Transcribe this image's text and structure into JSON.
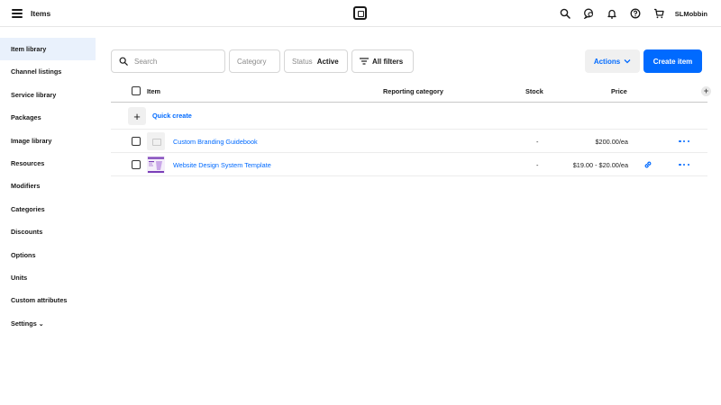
{
  "header": {
    "title": "Items",
    "username": "SLMobbin",
    "icons": [
      "hamburger-icon",
      "square-logo",
      "search-icon",
      "messages-icon",
      "bell-icon",
      "help-icon",
      "cart-icon"
    ]
  },
  "sidebar": {
    "items": [
      {
        "label": "Item library"
      },
      {
        "label": "Channel listings"
      },
      {
        "label": "Service library"
      },
      {
        "label": "Packages"
      },
      {
        "label": "Image library"
      },
      {
        "label": "Resources"
      },
      {
        "label": "Modifiers"
      },
      {
        "label": "Categories"
      },
      {
        "label": "Discounts"
      },
      {
        "label": "Options"
      },
      {
        "label": "Units"
      },
      {
        "label": "Custom attributes"
      },
      {
        "label": "Settings"
      }
    ],
    "active_index": 0
  },
  "toolbar": {
    "search_placeholder": "Search",
    "category_label": "Category",
    "status_label": "Status",
    "status_value": "Active",
    "all_filters_label": "All filters",
    "actions_label": "Actions",
    "create_label": "Create item"
  },
  "table": {
    "columns": [
      "Item",
      "Reporting category",
      "Stock",
      "Price"
    ],
    "quick_create_label": "Quick create",
    "rows": [
      {
        "name": "Custom Branding Guidebook",
        "reporting_category": "",
        "stock": "-",
        "price": "$200.00/ea",
        "thumbnail": "placeholder"
      },
      {
        "name": "Website Design System Template",
        "reporting_category": "",
        "stock": "-",
        "price": "$19.00 - $20.00/ea",
        "thumbnail": "image"
      }
    ]
  },
  "colors": {
    "accent": "#006aff",
    "active_nav_bg": "#e9f1fc",
    "border": "#d6d6d6"
  }
}
